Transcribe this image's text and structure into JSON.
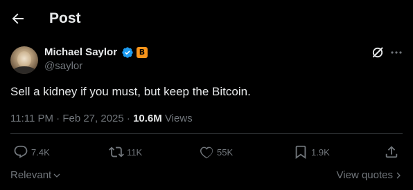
{
  "header": {
    "title": "Post",
    "back_icon": "arrow-left-icon"
  },
  "author": {
    "name": "Michael Saylor",
    "handle": "@saylor",
    "verified_color": "#1d9bf0",
    "badge_symbol": "B",
    "badge_color": "#f7931a"
  },
  "post": {
    "text": "Sell a kidney if you must, but keep the Bitcoin.",
    "time": "11:11 PM",
    "separator": "·",
    "date": "Feb 27, 2025",
    "views_count": "10.6M",
    "views_label": "Views"
  },
  "actions": {
    "reply_count": "7.4K",
    "repost_count": "11K",
    "like_count": "55K",
    "bookmark_count": "1.9K"
  },
  "footer": {
    "sort_label": "Relevant",
    "quotes_label": "View quotes"
  },
  "colors": {
    "background": "#000000",
    "text": "#e7e9ea",
    "secondary": "#71767b",
    "divider": "#2f3336"
  }
}
